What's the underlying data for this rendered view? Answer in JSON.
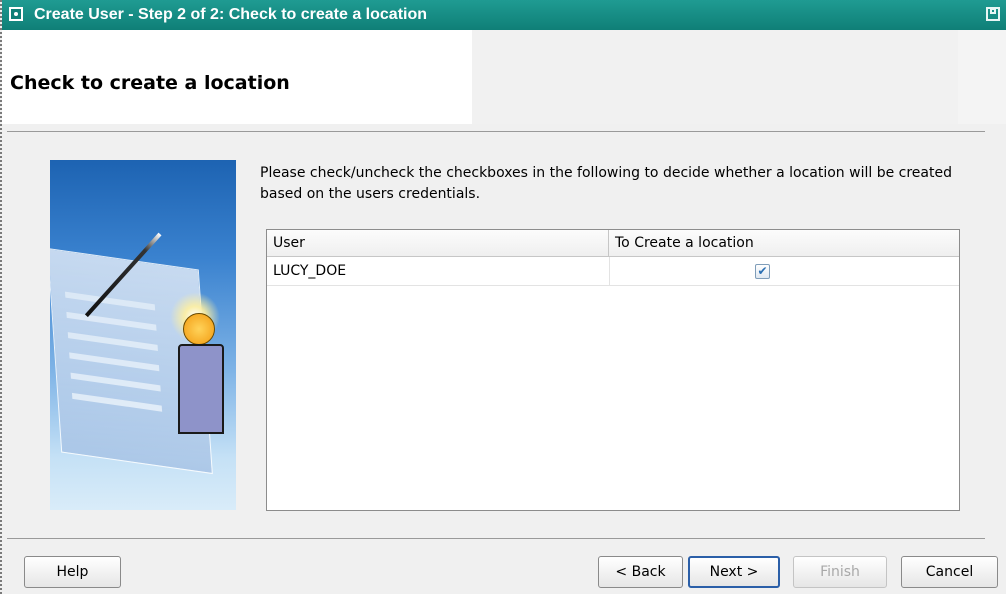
{
  "window": {
    "title": "Create User - Step 2 of 2: Check to create a location"
  },
  "header": {
    "title": "Check to create a location"
  },
  "main": {
    "instructions": "Please check/uncheck the checkboxes in the following to decide whether a location will be created based on the users credentials.",
    "table": {
      "columns": [
        "User",
        "To Create a location"
      ],
      "rows": [
        {
          "user": "LUCY_DOE",
          "create_location": true,
          "check_glyph": "✔"
        }
      ]
    }
  },
  "buttons": {
    "help": "Help",
    "back": "< Back",
    "next": "Next >",
    "finish": "Finish",
    "cancel": "Cancel"
  },
  "colors": {
    "titlebar": "#1f9b92",
    "focus_border": "#2b5fa8",
    "disabled_text": "#a8a8a8"
  },
  "icons": {
    "window_icon": "window-menu-icon",
    "maximize_icon": "maximize-icon",
    "wizard_image": "wizard-illustration"
  }
}
